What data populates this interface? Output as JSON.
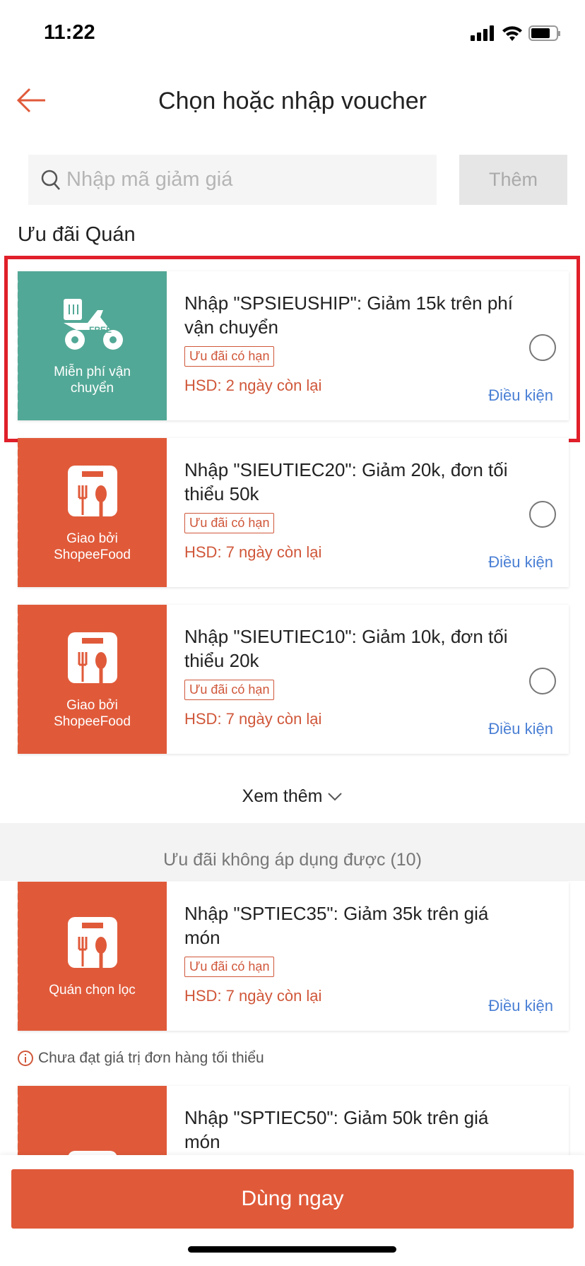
{
  "status_bar": {
    "time": "11:22"
  },
  "header": {
    "title": "Chọn hoặc nhập voucher"
  },
  "search": {
    "placeholder": "Nhập mã giảm giá",
    "value": "",
    "add_label": "Thêm"
  },
  "section_title": "Ưu đãi Quán",
  "colors": {
    "accent": "#e05a3a",
    "teal": "#52a896",
    "link": "#4a7fd4",
    "highlight": "#e0202a"
  },
  "vouchers": [
    {
      "name": "Nhập \"SPSIEUSHIP\": Giảm 15k trên phí vận chuyển",
      "tag": "Ưu đãi có hạn",
      "hsd": "HSD: 2 ngày còn lại",
      "cond": "Điều kiện",
      "label": "Miễn phí vận chuyển",
      "icon": "free-shipping-motorbike-icon",
      "selected": false
    },
    {
      "name": "Nhập \"SIEUTIEC20\": Giảm 20k, đơn tối thiểu 50k",
      "tag": "Ưu đãi có hạn",
      "hsd": "HSD: 7 ngày còn lại",
      "cond": "Điều kiện",
      "label": "Giao bởi ShopeeFood",
      "icon": "shopeefood-bag-icon",
      "selected": false
    },
    {
      "name": "Nhập \"SIEUTIEC10\": Giảm 10k, đơn tối thiểu 20k",
      "tag": "Ưu đãi có hạn",
      "hsd": "HSD: 7 ngày còn lại",
      "cond": "Điều kiện",
      "label": "Giao bởi ShopeeFood",
      "icon": "shopeefood-bag-icon",
      "selected": false
    }
  ],
  "see_more": "Xem thêm",
  "unavailable_title": "Ưu đãi không áp dụng được (10)",
  "unavailable": [
    {
      "name": "Nhập \"SPTIEC35\": Giảm 35k trên giá món",
      "tag": "Ưu đãi có hạn",
      "hsd": "HSD: 7 ngày còn lại",
      "cond": "Điều kiện",
      "label": "Quán chọn lọc",
      "icon": "shopeefood-bag-icon",
      "warning": "Chưa đạt giá trị đơn hàng tối thiểu"
    },
    {
      "name": "Nhập \"SPTIEC50\": Giảm 50k trên giá món"
    }
  ],
  "bottom": {
    "use_label": "Dùng ngay"
  }
}
